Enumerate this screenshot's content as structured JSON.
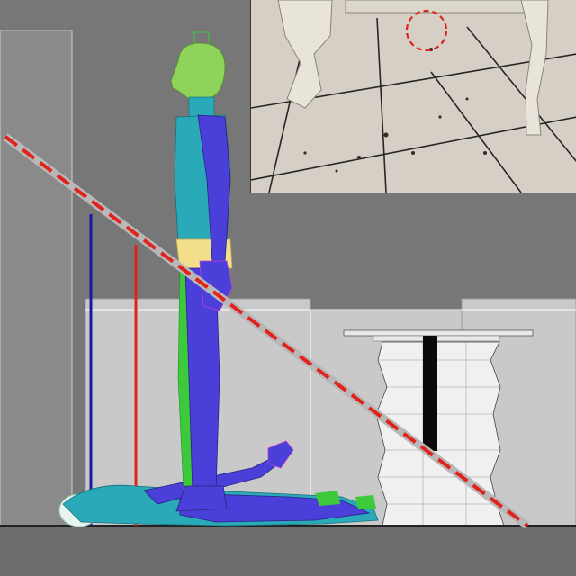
{
  "scene": {
    "type": "3D reconstruction render",
    "colors": {
      "background_wall": "#7a7a7a",
      "floor": "#6a6a6a",
      "trajectory_line": "#e0231c",
      "blue_marker_line": "#1c1ca8",
      "red_marker_line": "#e0231c",
      "figure_body": "#4a3fd8",
      "figure_torso": "#2aa9b8",
      "figure_head": "#8fd35a",
      "figure_pelvis": "#f2df8a"
    },
    "objects": [
      "standing-figure",
      "lying-figure",
      "cabinet-panels",
      "table-stand",
      "blood-trajectory-line",
      "height-marker-blue",
      "height-marker-red"
    ]
  },
  "photo_inset": {
    "description_icon": "photo-icon",
    "highlight_color": "#e0231c"
  }
}
